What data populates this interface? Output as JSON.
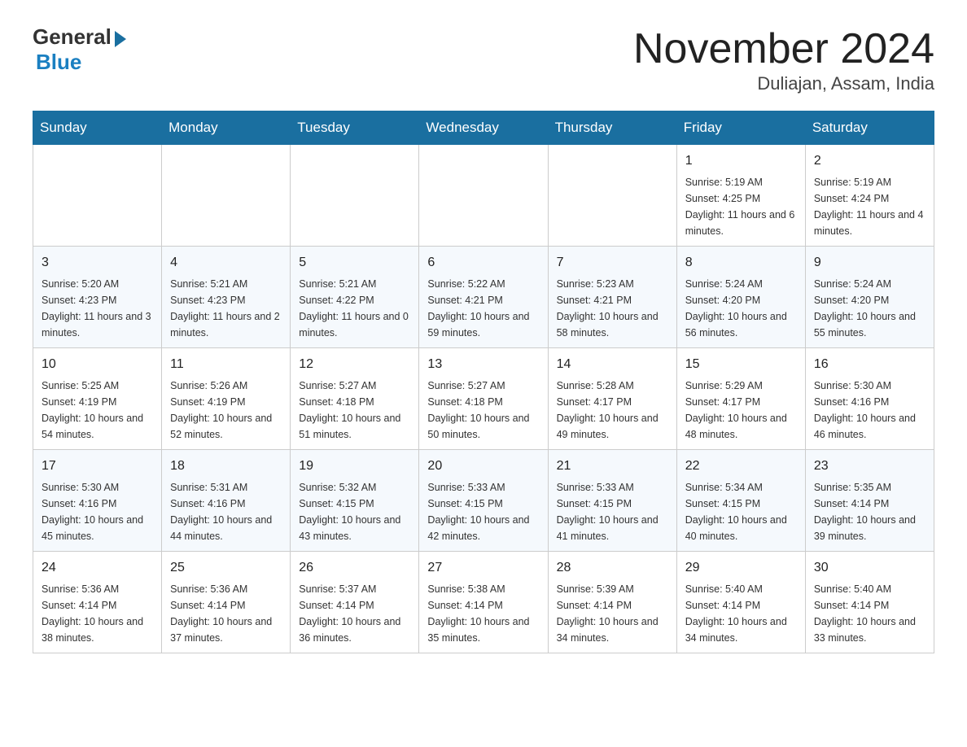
{
  "header": {
    "logo_general": "General",
    "logo_blue": "Blue",
    "month_title": "November 2024",
    "subtitle": "Duliajan, Assam, India"
  },
  "days_of_week": [
    "Sunday",
    "Monday",
    "Tuesday",
    "Wednesday",
    "Thursday",
    "Friday",
    "Saturday"
  ],
  "weeks": [
    [
      {
        "day": "",
        "info": ""
      },
      {
        "day": "",
        "info": ""
      },
      {
        "day": "",
        "info": ""
      },
      {
        "day": "",
        "info": ""
      },
      {
        "day": "",
        "info": ""
      },
      {
        "day": "1",
        "info": "Sunrise: 5:19 AM\nSunset: 4:25 PM\nDaylight: 11 hours and 6 minutes."
      },
      {
        "day": "2",
        "info": "Sunrise: 5:19 AM\nSunset: 4:24 PM\nDaylight: 11 hours and 4 minutes."
      }
    ],
    [
      {
        "day": "3",
        "info": "Sunrise: 5:20 AM\nSunset: 4:23 PM\nDaylight: 11 hours and 3 minutes."
      },
      {
        "day": "4",
        "info": "Sunrise: 5:21 AM\nSunset: 4:23 PM\nDaylight: 11 hours and 2 minutes."
      },
      {
        "day": "5",
        "info": "Sunrise: 5:21 AM\nSunset: 4:22 PM\nDaylight: 11 hours and 0 minutes."
      },
      {
        "day": "6",
        "info": "Sunrise: 5:22 AM\nSunset: 4:21 PM\nDaylight: 10 hours and 59 minutes."
      },
      {
        "day": "7",
        "info": "Sunrise: 5:23 AM\nSunset: 4:21 PM\nDaylight: 10 hours and 58 minutes."
      },
      {
        "day": "8",
        "info": "Sunrise: 5:24 AM\nSunset: 4:20 PM\nDaylight: 10 hours and 56 minutes."
      },
      {
        "day": "9",
        "info": "Sunrise: 5:24 AM\nSunset: 4:20 PM\nDaylight: 10 hours and 55 minutes."
      }
    ],
    [
      {
        "day": "10",
        "info": "Sunrise: 5:25 AM\nSunset: 4:19 PM\nDaylight: 10 hours and 54 minutes."
      },
      {
        "day": "11",
        "info": "Sunrise: 5:26 AM\nSunset: 4:19 PM\nDaylight: 10 hours and 52 minutes."
      },
      {
        "day": "12",
        "info": "Sunrise: 5:27 AM\nSunset: 4:18 PM\nDaylight: 10 hours and 51 minutes."
      },
      {
        "day": "13",
        "info": "Sunrise: 5:27 AM\nSunset: 4:18 PM\nDaylight: 10 hours and 50 minutes."
      },
      {
        "day": "14",
        "info": "Sunrise: 5:28 AM\nSunset: 4:17 PM\nDaylight: 10 hours and 49 minutes."
      },
      {
        "day": "15",
        "info": "Sunrise: 5:29 AM\nSunset: 4:17 PM\nDaylight: 10 hours and 48 minutes."
      },
      {
        "day": "16",
        "info": "Sunrise: 5:30 AM\nSunset: 4:16 PM\nDaylight: 10 hours and 46 minutes."
      }
    ],
    [
      {
        "day": "17",
        "info": "Sunrise: 5:30 AM\nSunset: 4:16 PM\nDaylight: 10 hours and 45 minutes."
      },
      {
        "day": "18",
        "info": "Sunrise: 5:31 AM\nSunset: 4:16 PM\nDaylight: 10 hours and 44 minutes."
      },
      {
        "day": "19",
        "info": "Sunrise: 5:32 AM\nSunset: 4:15 PM\nDaylight: 10 hours and 43 minutes."
      },
      {
        "day": "20",
        "info": "Sunrise: 5:33 AM\nSunset: 4:15 PM\nDaylight: 10 hours and 42 minutes."
      },
      {
        "day": "21",
        "info": "Sunrise: 5:33 AM\nSunset: 4:15 PM\nDaylight: 10 hours and 41 minutes."
      },
      {
        "day": "22",
        "info": "Sunrise: 5:34 AM\nSunset: 4:15 PM\nDaylight: 10 hours and 40 minutes."
      },
      {
        "day": "23",
        "info": "Sunrise: 5:35 AM\nSunset: 4:14 PM\nDaylight: 10 hours and 39 minutes."
      }
    ],
    [
      {
        "day": "24",
        "info": "Sunrise: 5:36 AM\nSunset: 4:14 PM\nDaylight: 10 hours and 38 minutes."
      },
      {
        "day": "25",
        "info": "Sunrise: 5:36 AM\nSunset: 4:14 PM\nDaylight: 10 hours and 37 minutes."
      },
      {
        "day": "26",
        "info": "Sunrise: 5:37 AM\nSunset: 4:14 PM\nDaylight: 10 hours and 36 minutes."
      },
      {
        "day": "27",
        "info": "Sunrise: 5:38 AM\nSunset: 4:14 PM\nDaylight: 10 hours and 35 minutes."
      },
      {
        "day": "28",
        "info": "Sunrise: 5:39 AM\nSunset: 4:14 PM\nDaylight: 10 hours and 34 minutes."
      },
      {
        "day": "29",
        "info": "Sunrise: 5:40 AM\nSunset: 4:14 PM\nDaylight: 10 hours and 34 minutes."
      },
      {
        "day": "30",
        "info": "Sunrise: 5:40 AM\nSunset: 4:14 PM\nDaylight: 10 hours and 33 minutes."
      }
    ]
  ]
}
